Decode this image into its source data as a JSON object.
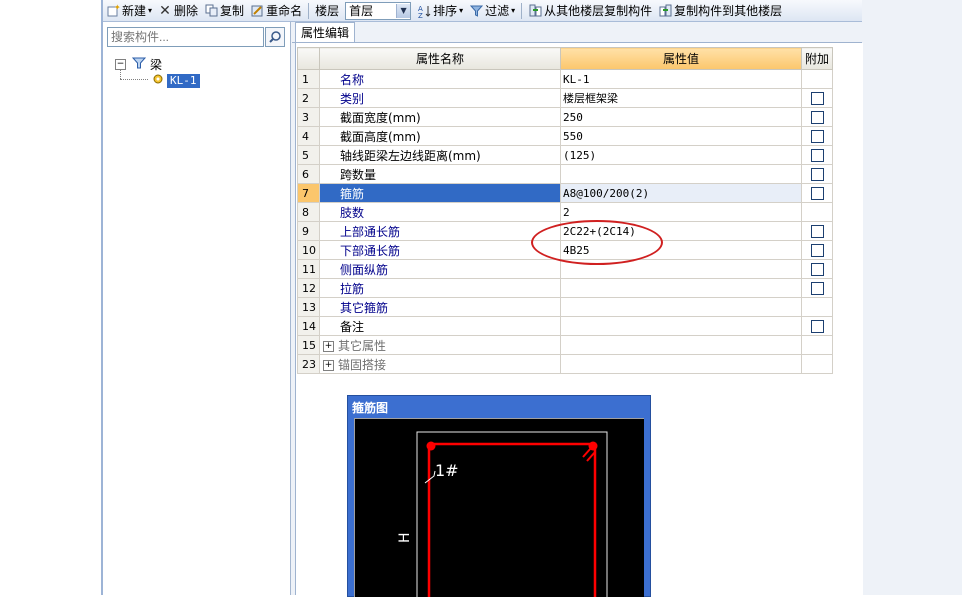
{
  "toolbar": {
    "new_label": "新建",
    "delete_label": "删除",
    "copy_label": "复制",
    "rename_label": "重命名",
    "floor_label": "楼层",
    "floor_value": "首层",
    "sort_label": "排序",
    "filter_label": "过滤",
    "copy_from_label": "从其他楼层复制构件",
    "copy_to_label": "复制构件到其他楼层"
  },
  "search": {
    "placeholder": "搜索构件..."
  },
  "tree": {
    "root_label": "梁",
    "child_label": "KL-1"
  },
  "tab_label": "属性编辑",
  "grid": {
    "headers": {
      "name": "属性名称",
      "value": "属性值",
      "extra": "附加"
    },
    "rows": [
      {
        "num": "1",
        "name": "名称",
        "value": "KL-1",
        "checkbox": false
      },
      {
        "num": "2",
        "name": "类别",
        "value": "楼层框架梁",
        "checkbox": true
      },
      {
        "num": "3",
        "name": "截面宽度(mm)",
        "value": "250",
        "checkbox": true
      },
      {
        "num": "4",
        "name": "截面高度(mm)",
        "value": "550",
        "checkbox": true
      },
      {
        "num": "5",
        "name": "轴线距梁左边线距离(mm)",
        "value": "(125)",
        "checkbox": true
      },
      {
        "num": "6",
        "name": "跨数量",
        "value": "",
        "checkbox": true
      },
      {
        "num": "7",
        "name": "箍筋",
        "value": "A8@100/200(2)",
        "checkbox": true
      },
      {
        "num": "8",
        "name": "肢数",
        "value": "2",
        "checkbox": false
      },
      {
        "num": "9",
        "name": "上部通长筋",
        "value": "2C22+(2C14)",
        "checkbox": true
      },
      {
        "num": "10",
        "name": "下部通长筋",
        "value": "4B25",
        "checkbox": true
      },
      {
        "num": "11",
        "name": "侧面纵筋",
        "value": "",
        "checkbox": true
      },
      {
        "num": "12",
        "name": "拉筋",
        "value": "",
        "checkbox": true
      },
      {
        "num": "13",
        "name": "其它箍筋",
        "value": "",
        "checkbox": false
      },
      {
        "num": "14",
        "name": "备注",
        "value": "",
        "checkbox": true
      },
      {
        "num": "15",
        "name": "其它属性",
        "value": "",
        "checkbox": false
      },
      {
        "num": "23",
        "name": "锚固搭接",
        "value": "",
        "checkbox": false
      }
    ]
  },
  "stirrup_dialog": {
    "title": "箍筋图",
    "bar_label": "1#",
    "dim_label": "H"
  },
  "colors": {
    "selection": "#316ac5",
    "header_accent": "#fbc66c",
    "annotation": "#d02020",
    "rebar": "#ff0000"
  }
}
